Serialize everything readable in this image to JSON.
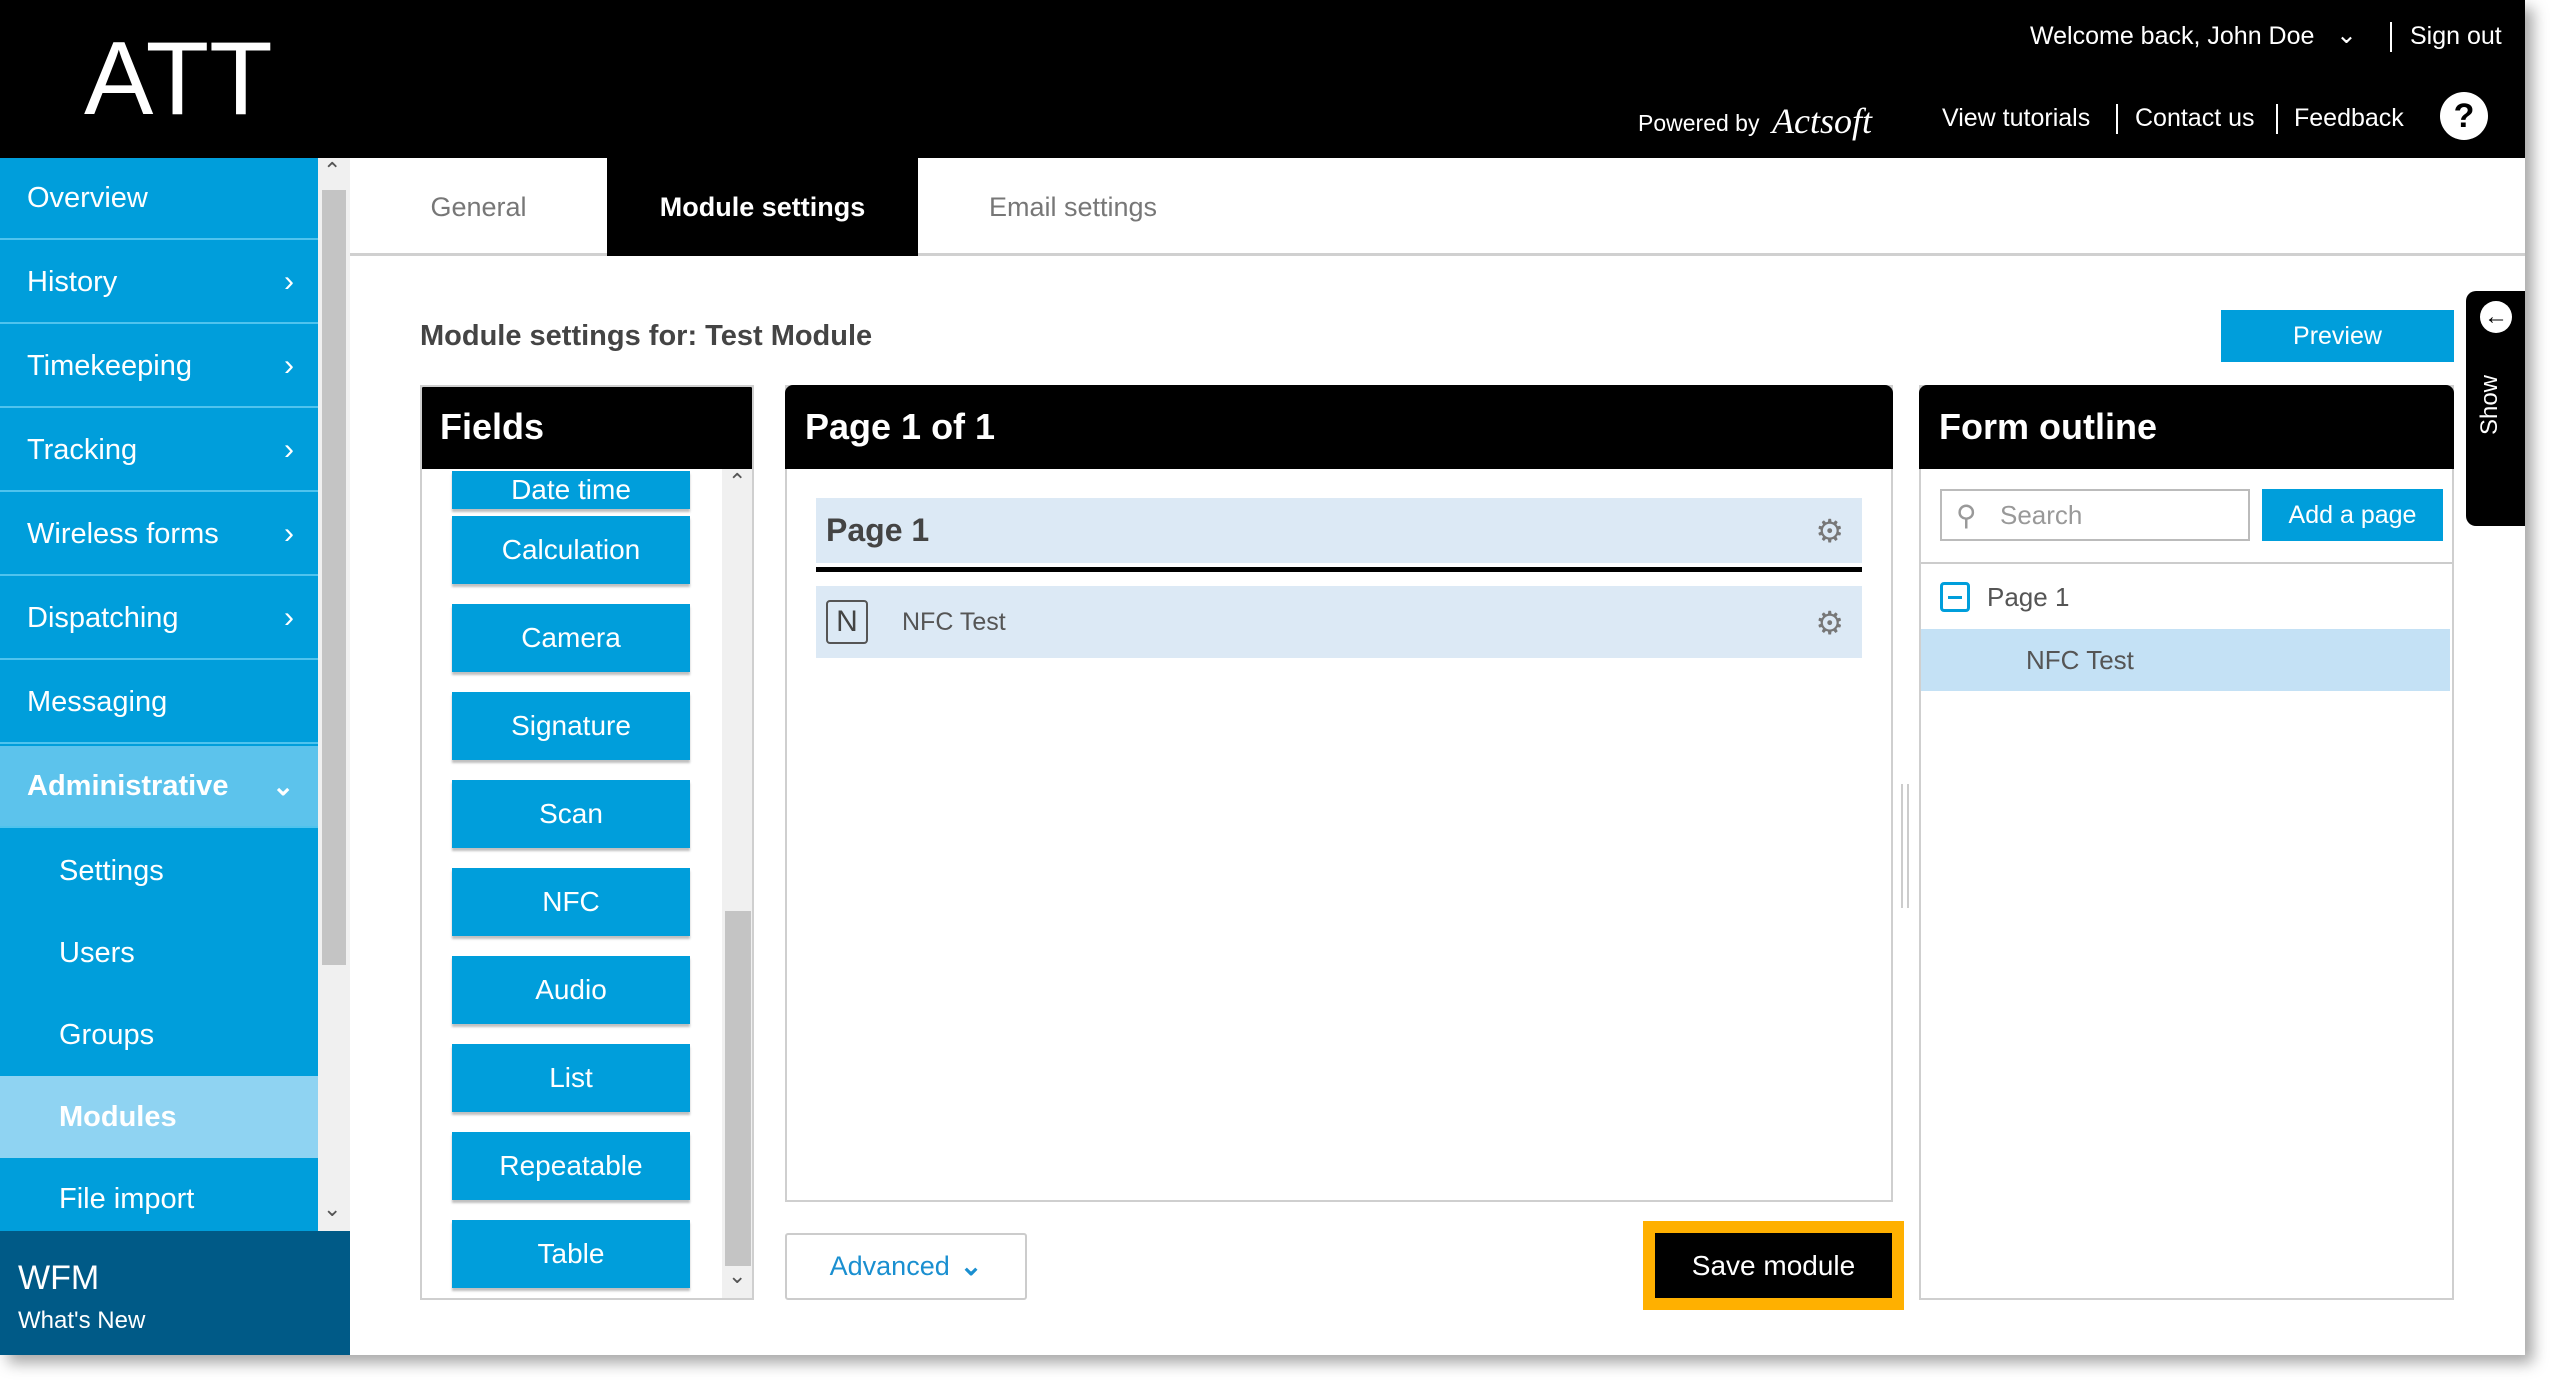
{
  "header": {
    "logo": "ATT",
    "welcome": "Welcome back, John Doe",
    "sign_out": "Sign out",
    "powered_by": "Powered by",
    "brand": "Actsoft",
    "view_tutorials": "View tutorials",
    "contact_us": "Contact us",
    "feedback": "Feedback",
    "help": "?"
  },
  "sidebar": {
    "items": [
      {
        "label": "Overview"
      },
      {
        "label": "History"
      },
      {
        "label": "Timekeeping"
      },
      {
        "label": "Tracking"
      },
      {
        "label": "Wireless forms"
      },
      {
        "label": "Dispatching"
      },
      {
        "label": "Messaging"
      },
      {
        "label": "Administrative"
      }
    ],
    "subitems": [
      {
        "label": "Settings"
      },
      {
        "label": "Users"
      },
      {
        "label": "Groups"
      },
      {
        "label": "Modules"
      },
      {
        "label": "File import"
      }
    ],
    "footer_title": "WFM",
    "footer_sub": "What's New"
  },
  "tabs": [
    {
      "label": "General"
    },
    {
      "label": "Module settings"
    },
    {
      "label": "Email settings"
    }
  ],
  "main": {
    "title": "Module settings for: Test Module",
    "preview": "Preview",
    "show": "Show"
  },
  "fields": {
    "title": "Fields",
    "partial": "Date time",
    "buttons": [
      "Calculation",
      "Camera",
      "Signature",
      "Scan",
      "NFC",
      "Audio",
      "List",
      "Repeatable",
      "Table"
    ]
  },
  "page": {
    "title": "Page 1 of 1",
    "page_name": "Page 1",
    "field_name": "NFC Test"
  },
  "outline": {
    "title": "Form outline",
    "search_placeholder": "Search",
    "add_page": "Add a page",
    "page": "Page 1",
    "field": "NFC Test"
  },
  "actions": {
    "advanced": "Advanced",
    "save": "Save module"
  },
  "colors": {
    "accent": "#009edb",
    "highlight": "#ffb000",
    "sidebar_footer": "#005a87"
  }
}
